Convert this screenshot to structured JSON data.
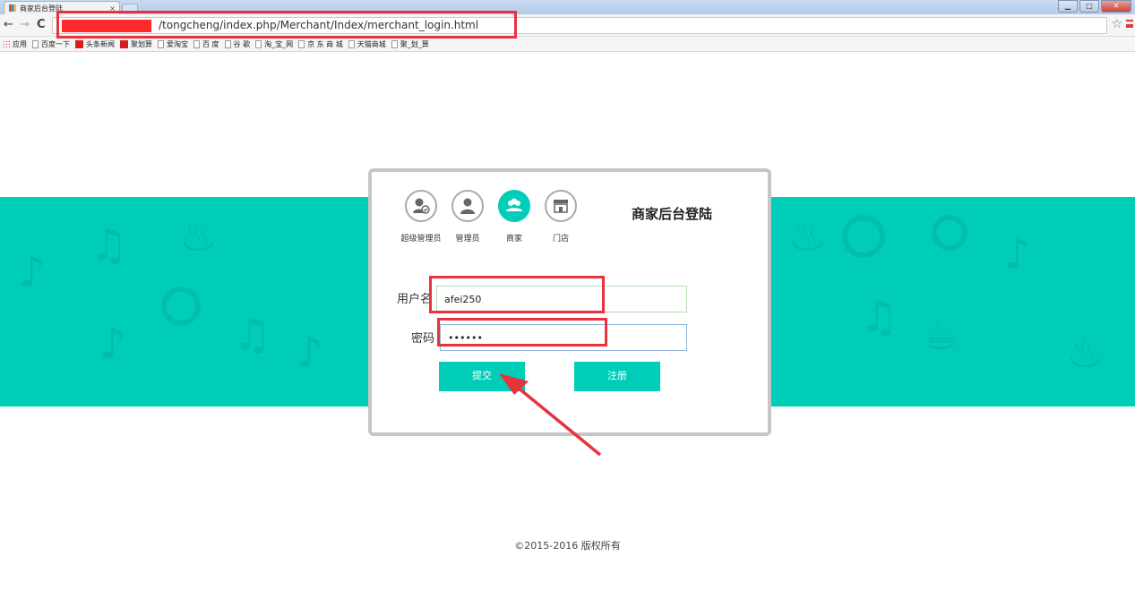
{
  "browser": {
    "tab_title": "商家后台登陆",
    "tab_close": "×",
    "url": "/tongcheng/index.php/Merchant/Index/merchant_login.html",
    "back": "←",
    "forward": "→",
    "reload": "C",
    "star": "☆",
    "window_controls": [
      "▁",
      "□",
      "✕"
    ],
    "bookmarks": [
      {
        "label": "应用",
        "icon": "apps-icon"
      },
      {
        "label": "百度一下",
        "icon": "page-icon"
      },
      {
        "label": "头条新闻",
        "icon": "news-icon"
      },
      {
        "label": "聚划算",
        "icon": "news-icon"
      },
      {
        "label": "爱淘宝",
        "icon": "page-icon"
      },
      {
        "label": "百 度",
        "icon": "page-icon"
      },
      {
        "label": "谷 歌",
        "icon": "page-icon"
      },
      {
        "label": "淘_宝_网",
        "icon": "page-icon"
      },
      {
        "label": "京 东 商 城",
        "icon": "page-icon"
      },
      {
        "label": "天猫商城",
        "icon": "page-icon"
      },
      {
        "label": "聚_划_算",
        "icon": "page-icon"
      }
    ]
  },
  "login": {
    "title": "商家后台登陆",
    "roles": [
      {
        "label": "超级管理员",
        "icon": "super-admin-icon",
        "active": false
      },
      {
        "label": "管理员",
        "icon": "admin-icon",
        "active": false
      },
      {
        "label": "商家",
        "icon": "merchant-icon",
        "active": true
      },
      {
        "label": "门店",
        "icon": "store-icon",
        "active": false
      }
    ],
    "username_label": "用户名",
    "username_value": "afei250",
    "password_label": "密码",
    "password_value": "••••••",
    "submit_label": "提交",
    "register_label": "注册"
  },
  "footer": {
    "copyright": "©2015-2016 版权所有"
  },
  "colors": {
    "accent": "#00cdb8",
    "annotation": "#e8323c"
  }
}
